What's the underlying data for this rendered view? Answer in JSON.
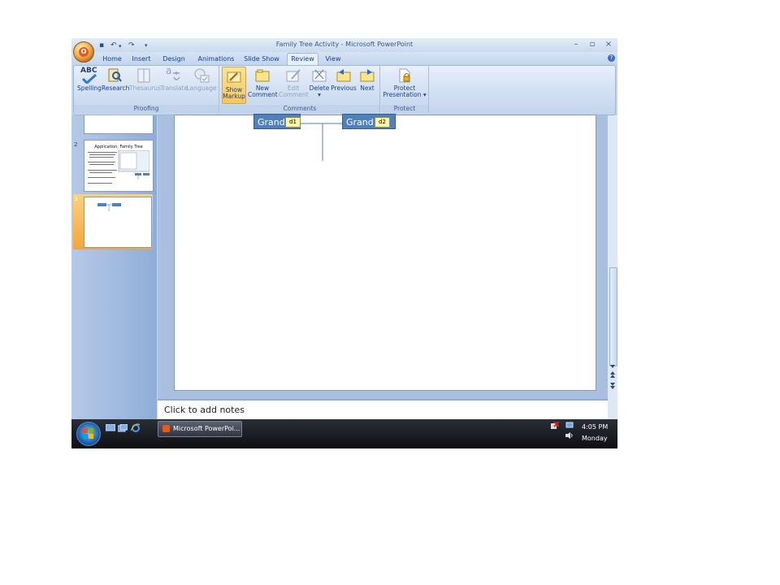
{
  "window": {
    "title": "Family Tree Activity - Microsoft PowerPoint",
    "office_logo": "O",
    "qat_icons": [
      "save-icon",
      "undo-icon",
      "redo-icon",
      "customize-qat-icon"
    ],
    "qat_glyphs": {
      "save": "▪",
      "undo": "↶",
      "undo_drop": "▾",
      "redo": "↷",
      "customize": "▾"
    },
    "controls": {
      "minimize": "–",
      "restore": "▫",
      "close": "×"
    }
  },
  "tabs": [
    {
      "label": "Home"
    },
    {
      "label": "Insert"
    },
    {
      "label": "Design"
    },
    {
      "label": "Animations"
    },
    {
      "label": "Slide Show"
    },
    {
      "label": "Review",
      "active": true
    },
    {
      "label": "View"
    }
  ],
  "help_glyph": "?",
  "ribbon": {
    "proofing": {
      "label": "Proofing",
      "buttons": [
        {
          "label": "Spelling",
          "icon": "spelling-icon",
          "glyph": "ABC"
        },
        {
          "label": "Research",
          "icon": "research-icon"
        },
        {
          "label": "Thesaurus",
          "icon": "thesaurus-icon",
          "disabled": true
        },
        {
          "label": "Translate",
          "icon": "translate-icon",
          "disabled": true,
          "glyph": "a"
        },
        {
          "label": "Language",
          "icon": "language-icon",
          "disabled": true
        }
      ]
    },
    "comments": {
      "label": "Comments",
      "buttons": [
        {
          "line1": "Show",
          "line2": "Markup",
          "icon": "show-markup-icon",
          "selected": true
        },
        {
          "line1": "New",
          "line2": "Comment",
          "icon": "new-comment-icon"
        },
        {
          "line1": "Edit",
          "line2": "Comment",
          "icon": "edit-comment-icon",
          "disabled": true
        },
        {
          "line1": "Delete",
          "line2": "▾",
          "icon": "delete-comment-icon"
        },
        {
          "line1": "Previous",
          "line2": "",
          "icon": "previous-comment-icon"
        },
        {
          "line1": "Next",
          "line2": "",
          "icon": "next-comment-icon"
        }
      ]
    },
    "protect": {
      "label": "Protect",
      "buttons": [
        {
          "line1": "Protect",
          "line2": "Presentation ▾",
          "icon": "protect-presentation-icon"
        }
      ]
    }
  },
  "slides_pane": {
    "slides": [
      {
        "number": "2",
        "title": "Application: Family Tree"
      },
      {
        "number": "3",
        "selected": true
      }
    ]
  },
  "slide": {
    "nodes": [
      {
        "label": "Grand",
        "comment": "d1"
      },
      {
        "label": "Grand",
        "comment": "d2"
      }
    ]
  },
  "notes": {
    "placeholder": "Click to add notes"
  },
  "taskbar": {
    "task_label": "Microsoft PowerPoi...",
    "time": "4:05 PM",
    "day": "Monday"
  },
  "colors": {
    "accent": "#4f81bd",
    "ribbon": "#cddcf0",
    "taskbar": "#1b1e24",
    "selected_button": "#f8c65b"
  }
}
